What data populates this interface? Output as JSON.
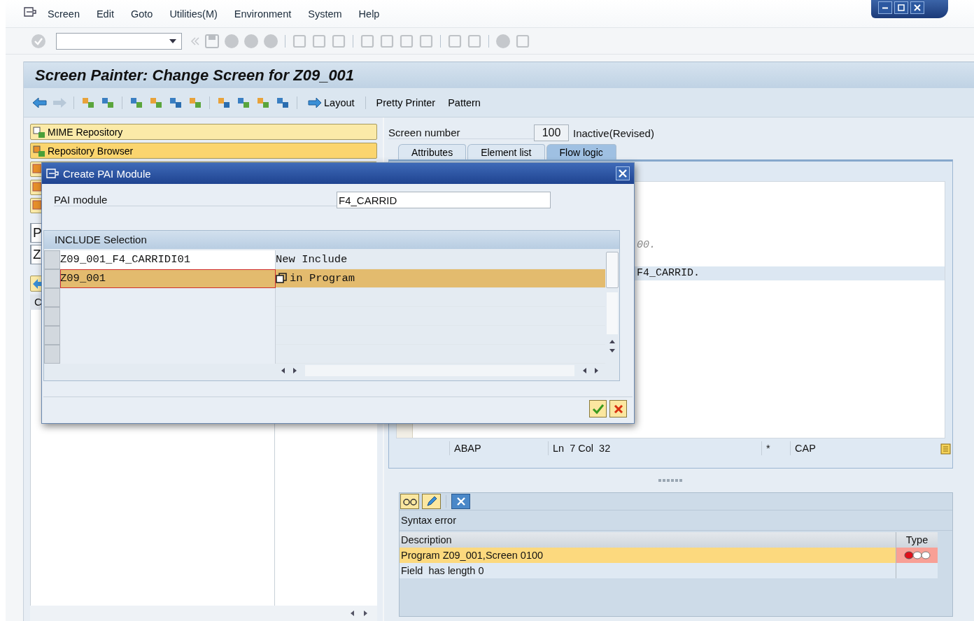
{
  "menu": [
    {
      "label": "Screen"
    },
    {
      "label": "Edit"
    },
    {
      "label": "Goto"
    },
    {
      "label": "Utilities(M)"
    },
    {
      "label": "Environment"
    },
    {
      "label": "System"
    },
    {
      "label": "Help"
    }
  ],
  "title": "Screen Painter: Change Screen for Z09_001",
  "app_toolbar": [
    {
      "label": "Layout"
    },
    {
      "label": "Pretty Printer"
    },
    {
      "label": "Pattern"
    }
  ],
  "navigator": {
    "buttons": [
      {
        "label": "MIME Repository",
        "selected": false
      },
      {
        "label": "Repository Browser",
        "selected": true
      }
    ],
    "fields": [
      "P",
      "Z"
    ],
    "column_1": "C"
  },
  "screen_number": {
    "label": "Screen number",
    "value": "100",
    "status": "Inactive(Revised)"
  },
  "tabs": [
    {
      "label": "Attributes",
      "selected": false
    },
    {
      "label": "Element list",
      "selected": false
    },
    {
      "label": "Flow logic",
      "selected": true
    }
  ],
  "editor": {
    "lines": [
      {
        "text": "00.",
        "kind": "comment",
        "selected": false
      },
      {
        "text": "F4_CARRID.",
        "kind": "code",
        "selected": true
      }
    ],
    "status": {
      "language": "ABAP",
      "position": "Ln  7 Col  32",
      "modified": "*",
      "caps": "CAP"
    }
  },
  "messages": {
    "title": "Syntax error",
    "columns": [
      "Description",
      "Type"
    ],
    "rows": [
      {
        "text": "Program Z09_001,Screen 0100",
        "kind": "error",
        "selected": true
      },
      {
        "text": "Field  has length 0",
        "kind": "text",
        "selected": false
      }
    ]
  },
  "dialog": {
    "title": "Create PAI Module",
    "field": {
      "label": "PAI module",
      "value": "F4_CARRID"
    },
    "group": "INCLUDE Selection",
    "rows": [
      {
        "name": "Z09_001_F4_CARRIDI01",
        "where": "New Include",
        "selected": false
      },
      {
        "name": "Z09_001",
        "where": "in Program",
        "selected": true
      }
    ]
  }
}
